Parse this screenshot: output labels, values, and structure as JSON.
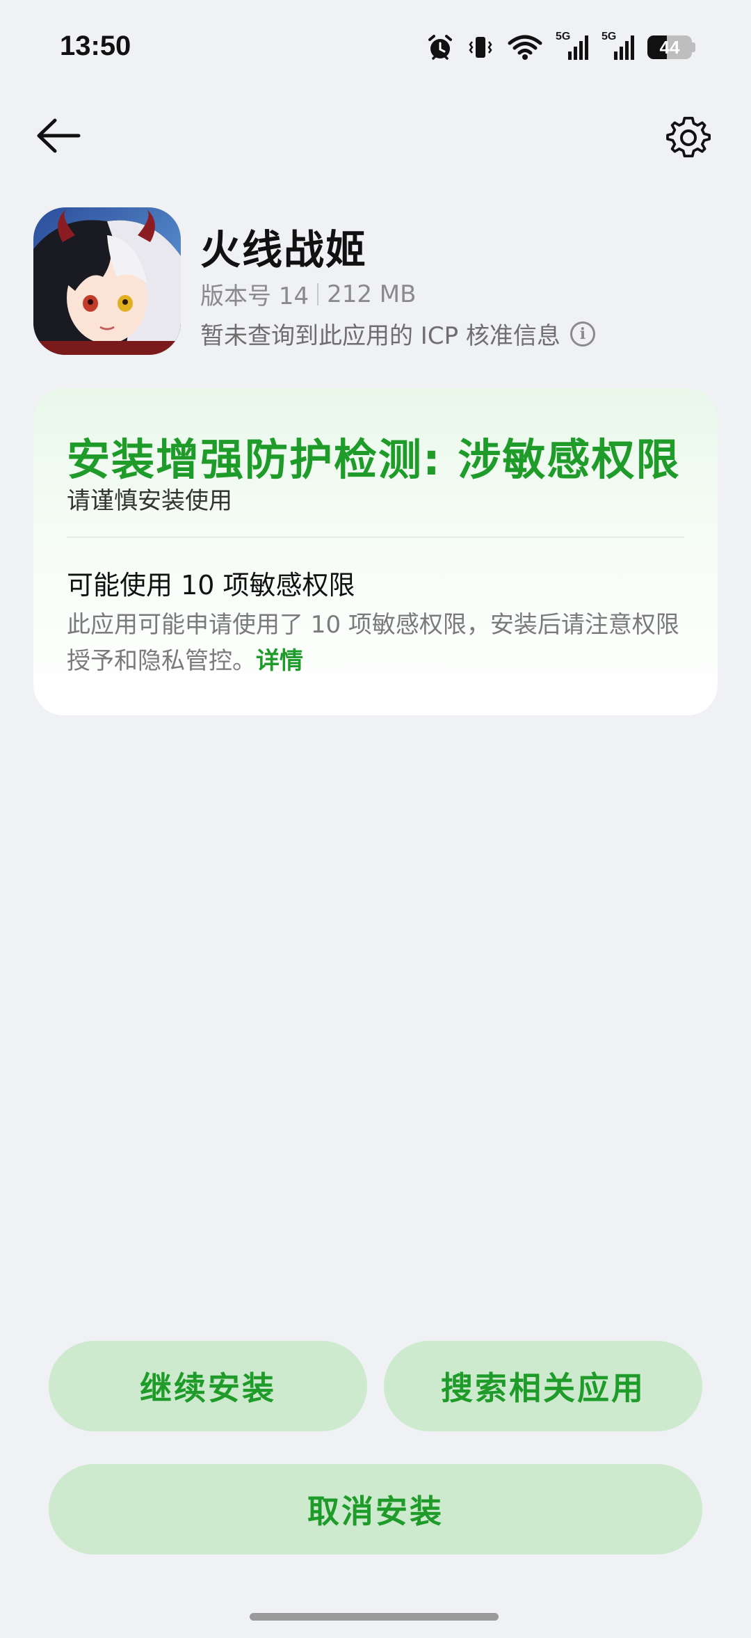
{
  "status_bar": {
    "time": "13:50",
    "battery": "44",
    "icons": [
      "alarm-icon",
      "vibrate-icon",
      "wifi-icon",
      "signal-5g-icon",
      "signal-5g-icon",
      "battery-icon"
    ],
    "signal_label": "5G"
  },
  "nav": {
    "back_icon": "arrow-left-icon",
    "settings_icon": "gear-icon"
  },
  "app": {
    "name": "火线战姬",
    "version": "版本号 14",
    "size": "212 MB",
    "icp_notice": "暂未查询到此应用的 ICP 核准信息",
    "info_icon_glyph": "i"
  },
  "warning": {
    "title": "安装增强防护检测: 涉敏感权限",
    "subtitle": "请谨慎安装使用",
    "permission_title": "可能使用 10 项敏感权限",
    "permission_desc": "此应用可能申请使用了 10 项敏感权限，安装后请注意权限授予和隐私管控。",
    "detail_link": "详情"
  },
  "actions": {
    "continue_install": "继续安装",
    "search_related": "搜索相关应用",
    "cancel_install": "取消安装"
  },
  "colors": {
    "accent_green": "#1f9b2a",
    "button_bg": "#cdeacf",
    "page_bg": "#eff1f4"
  }
}
